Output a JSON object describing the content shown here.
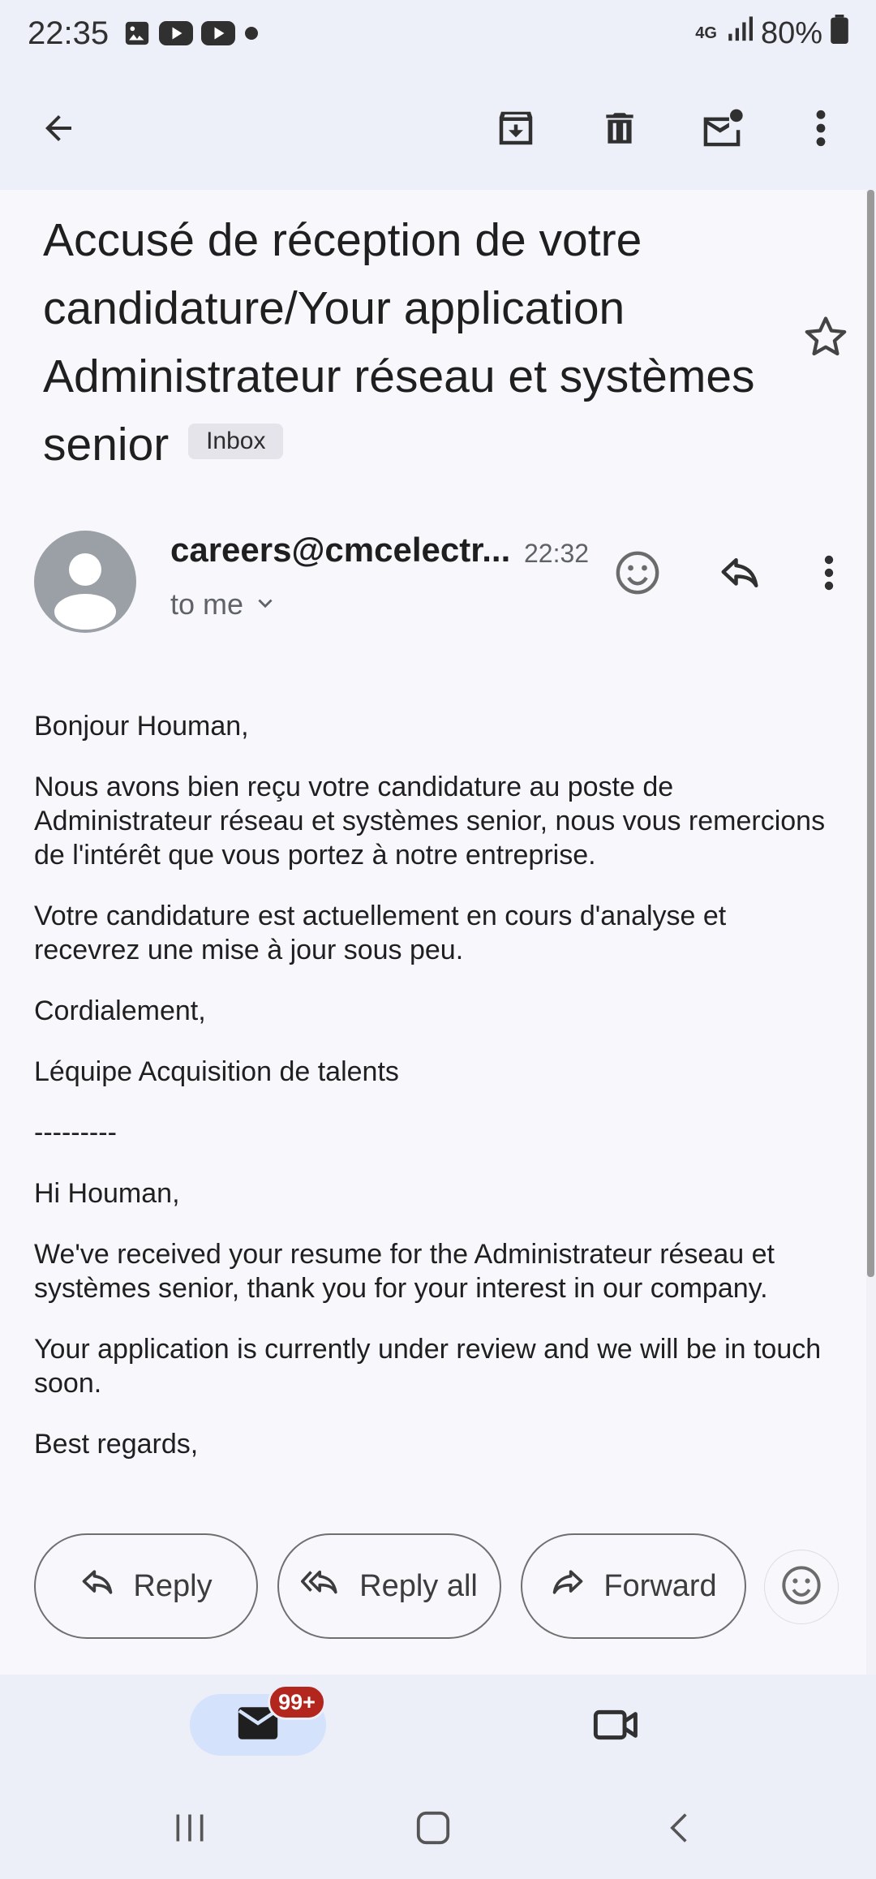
{
  "status_bar": {
    "time": "22:35",
    "network": "4G",
    "battery": "80%",
    "icons": [
      "image-icon",
      "youtube-icon",
      "youtube-icon",
      "dot-icon",
      "signal-icon",
      "battery-icon"
    ]
  },
  "toolbar": {
    "back": "back-arrow-icon",
    "archive": "archive-icon",
    "delete": "delete-icon",
    "mark_unread": "mark-unread-icon",
    "more": "more-vert-icon"
  },
  "email": {
    "subject": "Accusé de réception de votre candidature/Your application Administrateur réseau et systèmes senior",
    "label": "Inbox",
    "sender": "careers@cmcelectr...",
    "time": "22:32",
    "recipient": "to me",
    "body": [
      "Bonjour Houman,",
      "Nous avons bien reçu votre candidature au poste de Administrateur réseau et systèmes senior, nous vous remercions de l'intérêt que vous portez à notre entreprise.",
      "Votre candidature est actuellement en cours d'analyse et recevrez une mise à jour sous peu.",
      "Cordialement,",
      "Léquipe Acquisition de talents",
      "---------",
      "Hi Houman,",
      "We've received your resume for the Administrateur réseau et systèmes senior, thank you for your interest in our company.",
      "Your application is currently under review and we will be in touch soon.",
      "Best regards,"
    ]
  },
  "actions": {
    "reply": "Reply",
    "reply_all": "Reply all",
    "forward": "Forward"
  },
  "bottom_nav": {
    "mail_badge": "99+"
  },
  "colors": {
    "accent": "#d4e2fb",
    "badge": "#b3261e"
  }
}
